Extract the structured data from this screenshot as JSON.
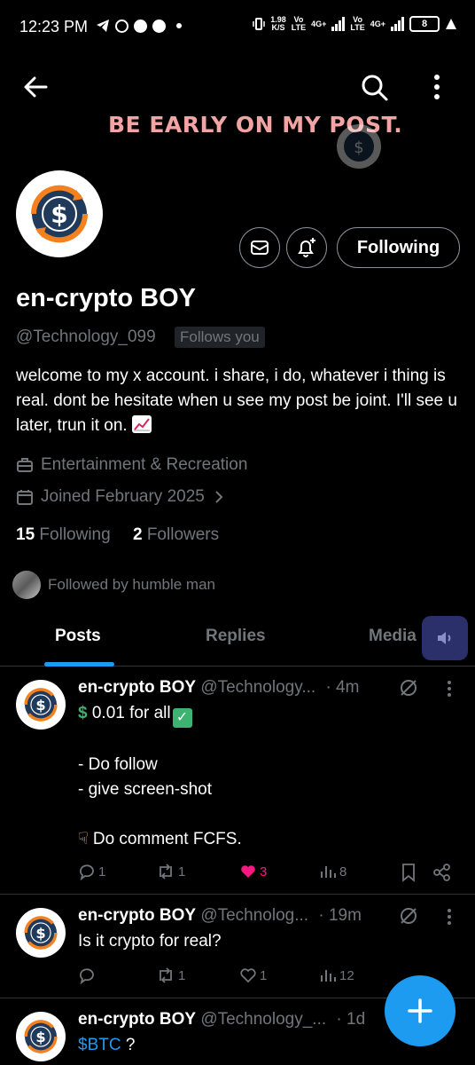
{
  "status_bar": {
    "time": "12:23 PM",
    "net_speed_top": "1.98",
    "net_speed_bottom": "K/S",
    "sim1_top": "Vo",
    "sim1_bottom": "LTE",
    "sim1_type": "4G+",
    "sim2_top": "Vo",
    "sim2_bottom": "LTE",
    "sim2_type": "4G+",
    "battery": "8"
  },
  "banner": {
    "text": "BE EARLY ON MY POST."
  },
  "profile": {
    "name": "en-crypto BOY",
    "handle": "@Technology_099",
    "follows_you": "Follows you",
    "bio": "welcome to my x account. i share, i do, whatever i thing is real. dont be hesitate when u see my post be joint. I'll see u later, trun it on.",
    "category": "Entertainment & Recreation",
    "joined": "Joined February 2025",
    "following_count": "15",
    "following_label": "Following",
    "followers_count": "2",
    "followers_label": "Followers",
    "followed_by": "Followed by humble man",
    "follow_button": "Following"
  },
  "tabs": [
    "Posts",
    "Replies",
    "Media"
  ],
  "posts": [
    {
      "name": "en-crypto BOY",
      "handle": "@Technology...",
      "time": "· 4m",
      "line1": "0.01 for all",
      "line2": "- Do follow",
      "line3": "- give screen-shot",
      "line4": "Do comment FCFS.",
      "replies": "1",
      "reposts": "1",
      "likes": "3",
      "views": "8"
    },
    {
      "name": "en-crypto BOY",
      "handle": "@Technolog...",
      "time": "· 19m",
      "line1": "Is it crypto for real?",
      "replies": "",
      "reposts": "1",
      "likes": "1",
      "views": "12"
    },
    {
      "name": "en-crypto BOY",
      "handle": "@Technology_...",
      "time": "· 1d",
      "cashtag": "$BTC",
      "line1": "?"
    }
  ],
  "colors": {
    "accent": "#1d9bf0",
    "like": "#f91880",
    "banner_text": "#f2a3a3",
    "logo_orange": "#f4811f",
    "logo_navy": "#1f3a5a"
  }
}
